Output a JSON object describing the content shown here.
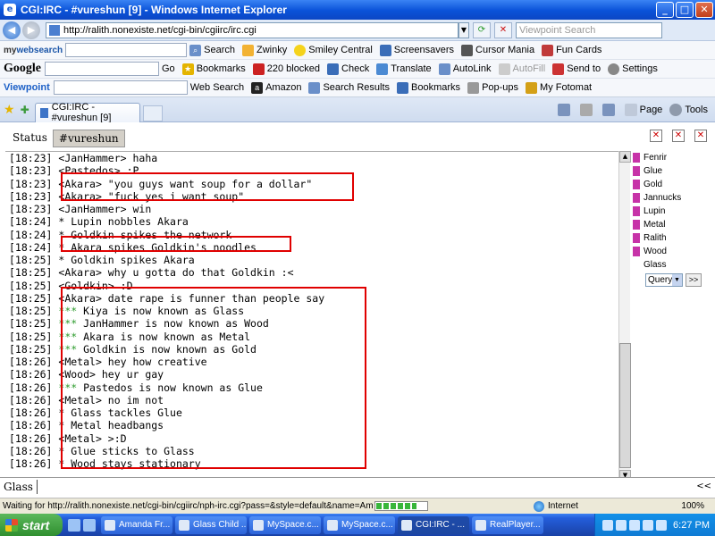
{
  "window": {
    "title": "CGI:IRC - #vureshun [9] - Windows Internet Explorer"
  },
  "address_bar": {
    "url": "http://ralith.nonexiste.net/cgi-bin/cgiirc/irc.cgi",
    "search_placeholder": "Viewpoint Search"
  },
  "toolbar1": {
    "brand_prefix": "my",
    "brand_suffix": "websearch",
    "items": [
      "Search",
      "Zwinky",
      "Smiley Central",
      "Screensavers",
      "Cursor Mania",
      "Fun Cards"
    ]
  },
  "toolbar2": {
    "google": "Google",
    "go": "Go",
    "items": [
      "Bookmarks",
      "220 blocked",
      "Check",
      "Translate",
      "AutoLink",
      "AutoFill",
      "Send to",
      "Settings"
    ]
  },
  "toolbar3": {
    "viewpoint": "Viewpoint",
    "items": [
      "Web Search",
      "Amazon",
      "Search Results",
      "Bookmarks",
      "Pop-ups",
      "My Fotomat"
    ]
  },
  "tabs": {
    "active_tab": "CGI:IRC - #vureshun [9]",
    "commands": [
      "Page",
      "Tools"
    ]
  },
  "irc": {
    "tabs": [
      "Status",
      "#vureshun"
    ],
    "log": [
      {
        "time": "[18:23]",
        "text": "<JanHammer> haha"
      },
      {
        "time": "[18:23]",
        "text": "<Pastedos> :P"
      },
      {
        "time": "[18:23]",
        "text": "<Akara> \"you guys want soup for a dollar\""
      },
      {
        "time": "[18:23]",
        "text": "<Akara> \"fuck yes i want soup\""
      },
      {
        "time": "[18:23]",
        "text": "<JanHammer> win"
      },
      {
        "time": "[18:24]",
        "text": "* Lupin nobbles Akara"
      },
      {
        "time": "[18:24]",
        "text": "* Goldkin spikes the network"
      },
      {
        "time": "[18:24]",
        "text": "* Akara spikes Goldkin's noodles"
      },
      {
        "time": "[18:25]",
        "text": "* Goldkin spikes Akara"
      },
      {
        "time": "[18:25]",
        "text": "<Akara> why u gotta do that Goldkin :<"
      },
      {
        "time": "[18:25]",
        "text": "<Goldkin> :D"
      },
      {
        "time": "[18:25]",
        "text": "<Akara> date rape is funner than people say"
      },
      {
        "time": "[18:25]",
        "stars": "***",
        "text": " Kiya is now known as Glass"
      },
      {
        "time": "[18:25]",
        "stars": "***",
        "text": " JanHammer is now known as Wood"
      },
      {
        "time": "[18:25]",
        "stars": "***",
        "text": " Akara is now known as Metal"
      },
      {
        "time": "[18:25]",
        "stars": "***",
        "text": " Goldkin is now known as Gold"
      },
      {
        "time": "[18:26]",
        "text": "<Metal> hey how creative"
      },
      {
        "time": "[18:26]",
        "text": "<Wood> hey ur gay"
      },
      {
        "time": "[18:26]",
        "stars": "***",
        "text": " Pastedos is now known as Glue"
      },
      {
        "time": "[18:26]",
        "text": "<Metal> no im not"
      },
      {
        "time": "[18:26]",
        "text": "* Glass tackles Glue"
      },
      {
        "time": "[18:26]",
        "text": "* Metal headbangs"
      },
      {
        "time": "[18:26]",
        "text": "<Metal> >:D"
      },
      {
        "time": "[18:26]",
        "text": "* Glue sticks to Glass"
      },
      {
        "time": "[18:26]",
        "text": "* Wood stays stationary"
      }
    ],
    "nicks_ops": [
      "Fenrir",
      "Glue",
      "Gold",
      "Jannucks",
      "Lupin",
      "Metal",
      "Ralith",
      "Wood"
    ],
    "nicks_plain": [
      "Glass"
    ],
    "query_label": "Query",
    "query_go": ">>",
    "input_nick": "Glass",
    "input_scroll": "<<"
  },
  "status_bar": {
    "message": "Waiting for http://ralith.nonexiste.net/cgi-bin/cgiirc/nph-irc.cgi?pass=&style=default&name=Amanda&charse",
    "zone": "Internet",
    "zoom": "100%",
    "progress_fraction": 0.8
  },
  "taskbar": {
    "start": "start",
    "buttons": [
      "Amanda Fr...",
      "Glass Child ...",
      "MySpace.c...",
      "MySpace.c...",
      "CGI:IRC - ...",
      "RealPlayer..."
    ],
    "active_index": 4,
    "clock": "6:27 PM"
  },
  "colors": {
    "highlight_box": "#e00000",
    "nick_op": "#c733a8",
    "stars": "#2a9a2a"
  }
}
